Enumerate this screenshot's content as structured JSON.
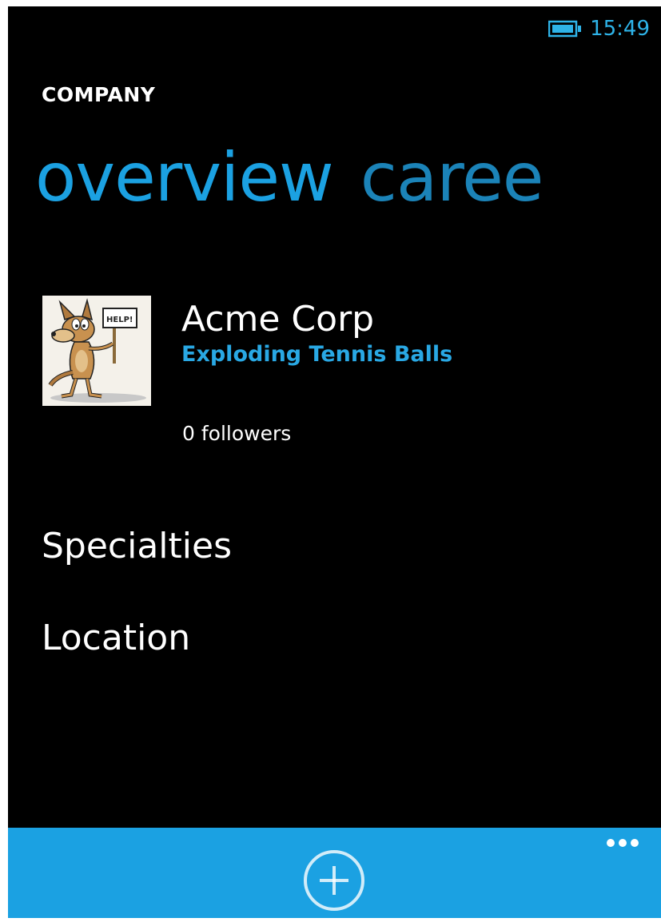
{
  "status_bar": {
    "time": "15:49",
    "battery_icon": "battery-icon"
  },
  "app_title": "COMPANY",
  "pivot": {
    "tabs": [
      {
        "label": "overview",
        "active": true
      },
      {
        "label": "caree",
        "active": false
      }
    ]
  },
  "company": {
    "logo_icon": "company-logo",
    "logo_sign_text": "HELP!",
    "name": "Acme Corp",
    "industry": "Exploding Tennis Balls",
    "followers": "0 followers"
  },
  "sections": {
    "specialties": "Specialties",
    "location": "Location"
  },
  "app_bar": {
    "add_icon": "add-circle-icon",
    "more_icon": "ellipsis-icon"
  },
  "colors": {
    "accent": "#1ba1e2",
    "background": "#000000",
    "text": "#ffffff"
  }
}
